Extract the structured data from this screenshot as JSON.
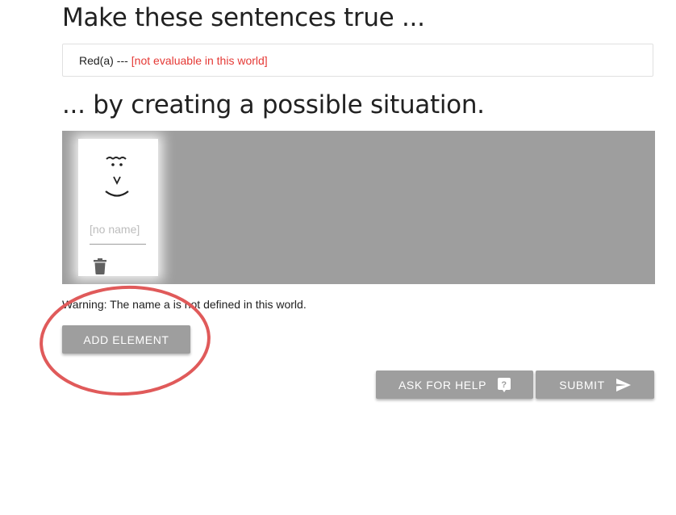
{
  "heading_make_true": "Make these sentences true ...",
  "sentences": [
    {
      "formula": "Red(a)",
      "separator": "---",
      "status": "[not evaluable in this world]",
      "status_color": "#e53935"
    }
  ],
  "heading_situation": "... by creating a possible situation.",
  "world": {
    "background_color": "#9e9e9e",
    "elements": [
      {
        "name_value": "",
        "name_placeholder": "[no name]",
        "delete_icon": "trash-icon"
      }
    ]
  },
  "warning": "Warning: The name a is not defined in this world.",
  "buttons": {
    "add_element": "ADD ELEMENT",
    "ask_for_help": "ASK FOR HELP",
    "ask_for_help_icon": "help-icon",
    "submit": "SUBMIT",
    "submit_icon": "send-icon"
  },
  "annotation": {
    "color": "#e05a5a"
  }
}
